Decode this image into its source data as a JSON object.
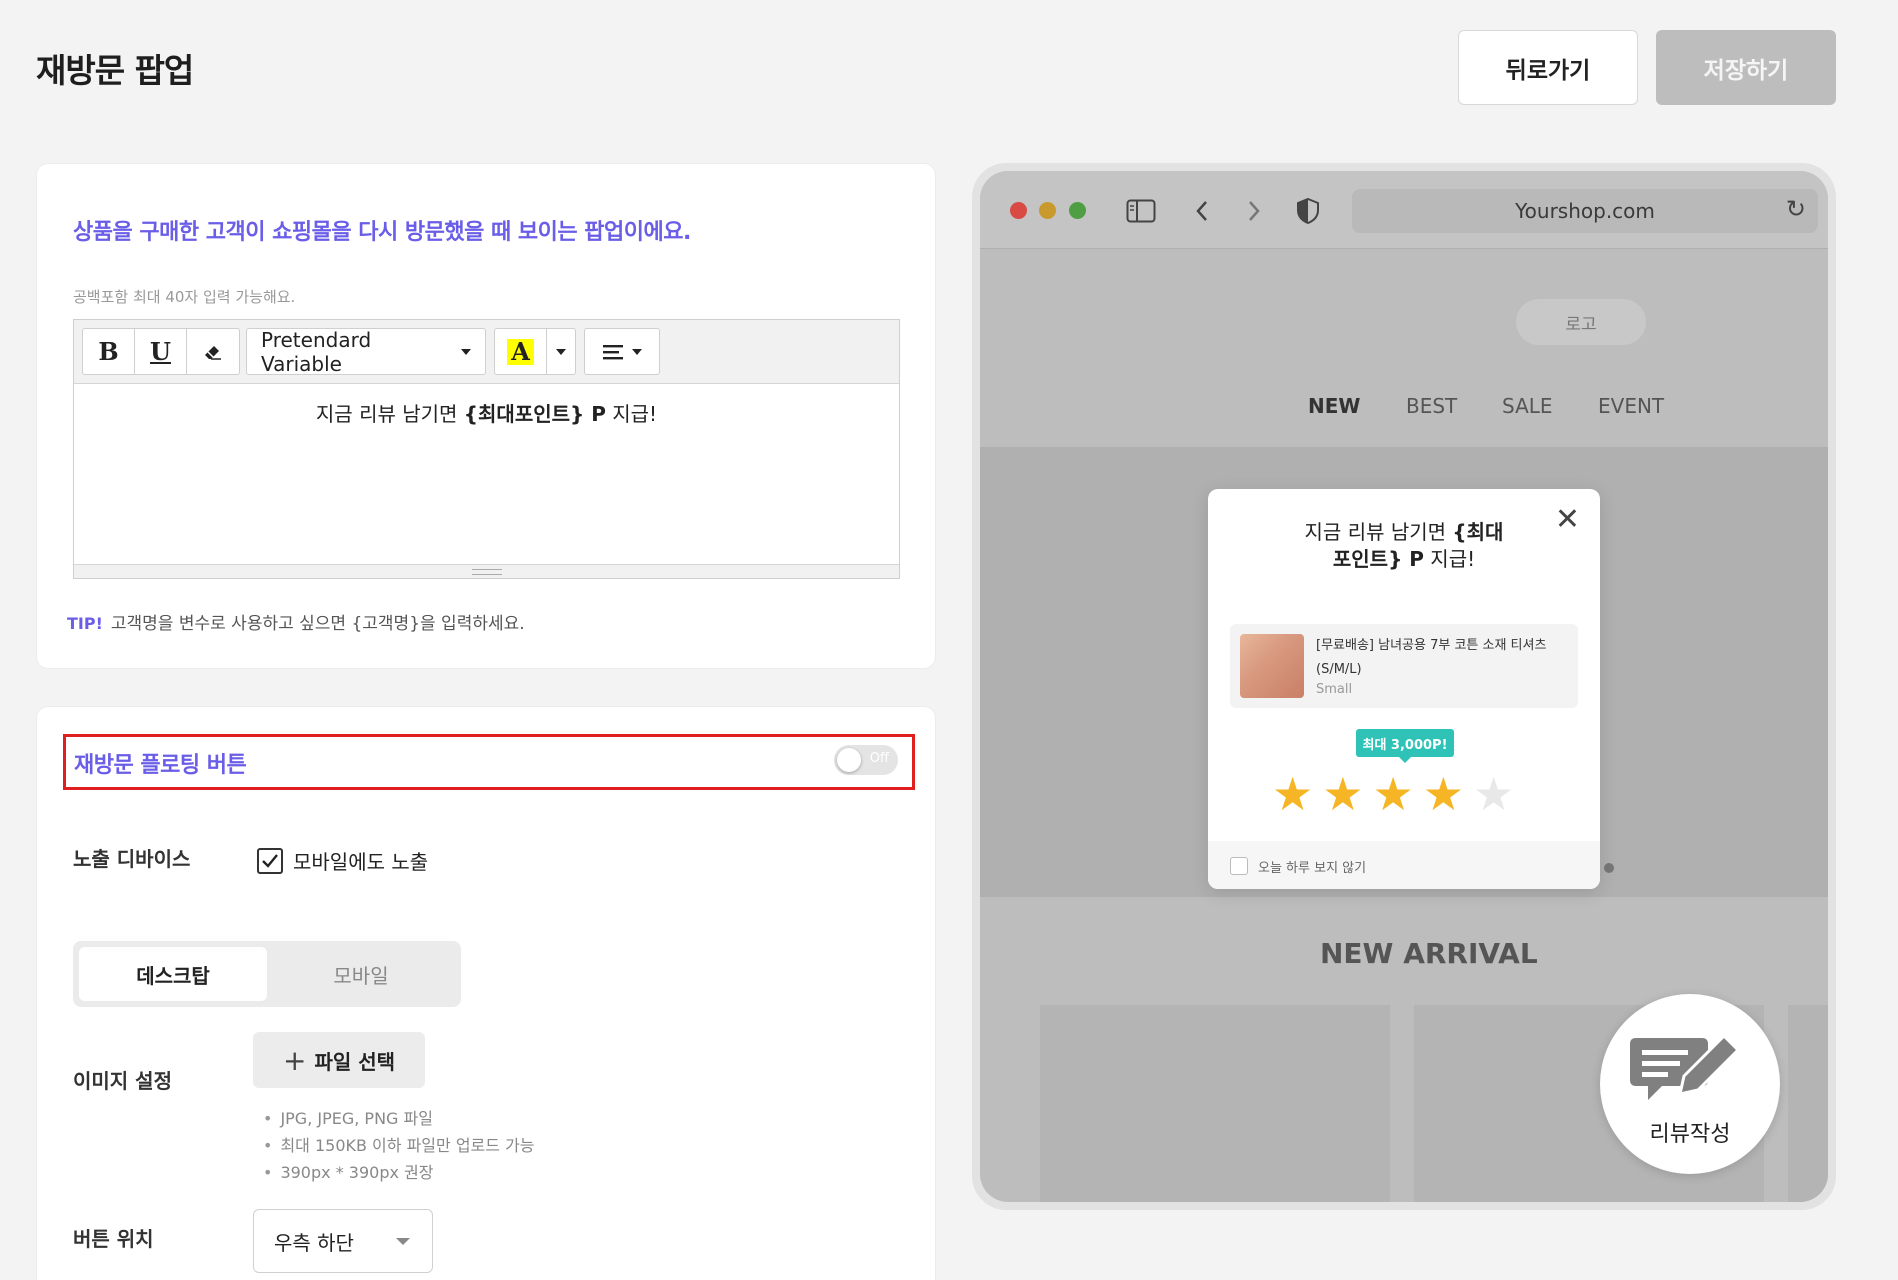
{
  "header": {
    "title": "재방문 팝업",
    "back_label": "뒤로가기",
    "save_label": "저장하기"
  },
  "popup_settings": {
    "heading": "상품을 구매한 고객이 쇼핑몰을 다시 방문했을 때 보이는 팝업이에요.",
    "hint": "공백포함 최대 40자 입력 가능해요.",
    "toolbar": {
      "bold": "B",
      "underline": "U",
      "font_name": "Pretendard Variable",
      "color_glyph": "A"
    },
    "editor_text_prefix": "지금 리뷰 남기면 ",
    "editor_text_bold": "{최대포인트} P",
    "editor_text_suffix": " 지급!",
    "tip_label": "TIP!",
    "tip_text": "고객명을 변수로 사용하고 싶으면 {고객명}을 입력하세요."
  },
  "floating_button": {
    "heading": "재방문 플로팅 버튼",
    "toggle_text": "Off",
    "toggle_on": false,
    "device_label": "노출 디바이스",
    "mobile_checkbox_label": "모바일에도 노출",
    "mobile_checked": true,
    "tabs": [
      "데스크탑",
      "모바일"
    ],
    "active_tab": "데스크탑",
    "image_label": "이미지 설정",
    "file_button_label": "파일 선택",
    "file_notes": [
      "JPG, JPEG, PNG 파일",
      "최대 150KB 이하 파일만 업로드 가능",
      "390px * 390px 권장"
    ],
    "position_label": "버튼 위치",
    "position_value": "우측 하단"
  },
  "preview": {
    "url": "Yourshop.com",
    "logo": "로고",
    "nav": [
      "NEW",
      "BEST",
      "SALE",
      "EVENT"
    ],
    "active_nav": "NEW",
    "section_title": "NEW ARRIVAL",
    "fab_label": "리뷰작성",
    "popup": {
      "message_line1_prefix": "지금 리뷰 남기면 ",
      "message_line1_bold": "{최대",
      "message_line2_bold": "포인트} P",
      "message_line2_suffix": " 지급!",
      "product_name": "[무료배송] 남녀공용 7부 코튼 소재 티셔츠 (S/M/L)",
      "product_variant": "Small",
      "badge": "최대 3,000P!",
      "rating": 4,
      "rating_max": 5,
      "dont_show_today": "오늘 하루 보지 않기"
    }
  },
  "colors": {
    "accent_purple": "#6a5ee8",
    "highlight_red": "#e02020",
    "badge_teal": "#2fc3b8",
    "star_gold": "#f6b524"
  }
}
